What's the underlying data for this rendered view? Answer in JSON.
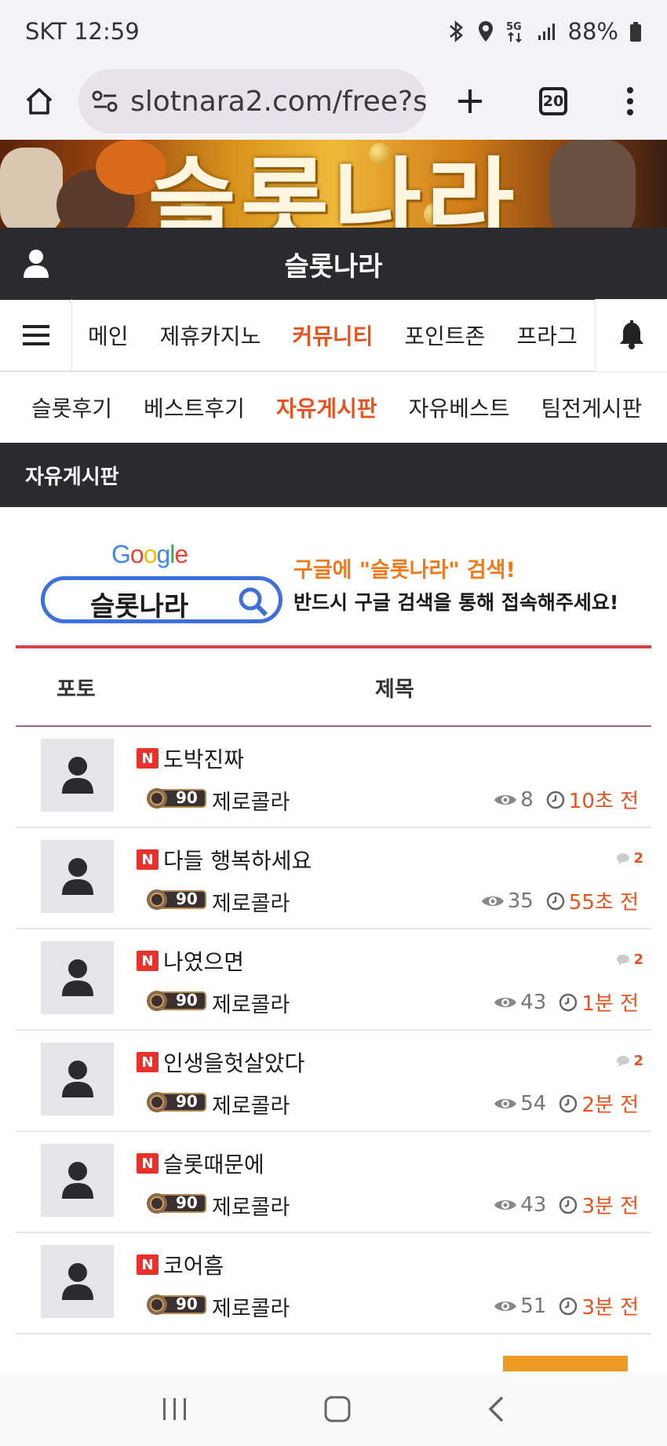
{
  "status_bar": {
    "carrier_time": "SKT 12:59",
    "network": "5G",
    "battery": "88%"
  },
  "browser": {
    "url": "slotnara2.com/free?s",
    "tab_count": "20"
  },
  "banner": {
    "text": "슬롯나라"
  },
  "site": {
    "title": "슬롯나라"
  },
  "main_nav": {
    "items": [
      {
        "label": "메인"
      },
      {
        "label": "제휴카지노"
      },
      {
        "label": "커뮤니티",
        "active": true
      },
      {
        "label": "포인트존"
      },
      {
        "label": "프라그"
      }
    ]
  },
  "sub_nav": {
    "items": [
      {
        "label": "슬롯후기"
      },
      {
        "label": "베스트후기"
      },
      {
        "label": "자유게시판",
        "active": true
      },
      {
        "label": "자유베스트"
      },
      {
        "label": "팀전게시판"
      }
    ]
  },
  "board": {
    "title": "자유게시판"
  },
  "ad": {
    "google_logo": "Google",
    "search_text": "슬롯나라",
    "line1": "구글에 \"슬롯나라\" 검색!",
    "line2": "반드시 구글 검색을 통해 접속해주세요!"
  },
  "table_header": {
    "photo": "포토",
    "title": "제목"
  },
  "new_badge": "N",
  "posts": [
    {
      "title": "도박진짜",
      "comments": "",
      "level": "90",
      "author": "제로콜라",
      "views": "8",
      "time": "10초 전"
    },
    {
      "title": "다들 행복하세요",
      "comments": "2",
      "level": "90",
      "author": "제로콜라",
      "views": "35",
      "time": "55초 전"
    },
    {
      "title": "나였으면",
      "comments": "2",
      "level": "90",
      "author": "제로콜라",
      "views": "43",
      "time": "1분 전"
    },
    {
      "title": "인생을헛살았다",
      "comments": "2",
      "level": "90",
      "author": "제로콜라",
      "views": "54",
      "time": "2분 전"
    },
    {
      "title": "슬롯때문에",
      "comments": "",
      "level": "90",
      "author": "제로콜라",
      "views": "43",
      "time": "3분 전"
    },
    {
      "title": "코어흠",
      "comments": "",
      "level": "90",
      "author": "제로콜라",
      "views": "51",
      "time": "3분 전"
    }
  ],
  "colors": {
    "accent": "#e8521e",
    "dark_bar": "#2b2b2d",
    "new_badge": "#e8312a",
    "table_rule": "#d7414a"
  }
}
